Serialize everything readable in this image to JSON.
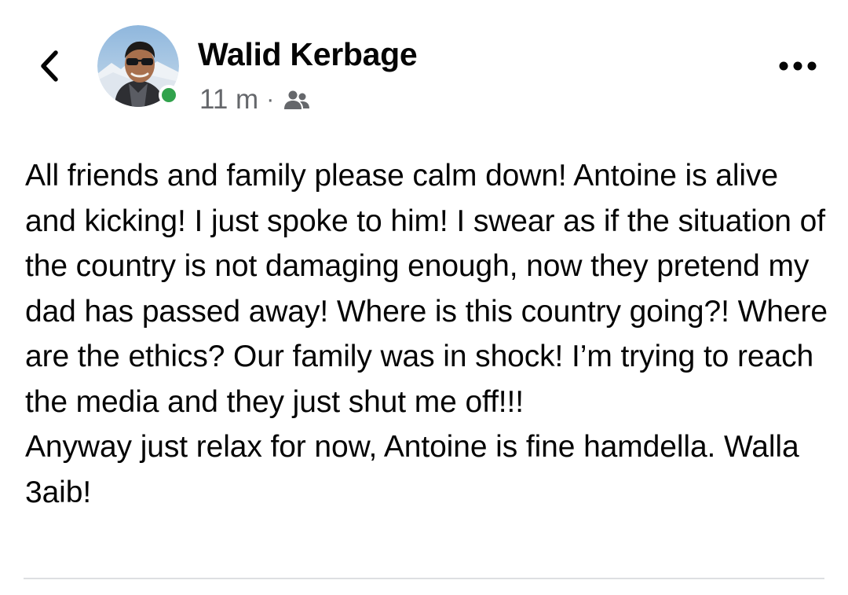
{
  "header": {
    "back_icon": "chevron-left-icon",
    "more_icon": "ellipsis-icon"
  },
  "author": {
    "name": "Walid Kerbage",
    "online": true,
    "avatar": "profile-photo"
  },
  "meta": {
    "time": "11 m",
    "separator": "·",
    "audience_icon": "friends-icon"
  },
  "post": {
    "text": "All friends and family please calm down! Antoine is alive and kicking! I just spoke to him! I swear as if the situation of the country is not damaging enough, now they pretend my dad has passed away! Where is this country going?! Where are the ethics? Our family was in shock! I’m trying to reach the media and they just shut me off!!!\nAnyway just relax for now, Antoine is fine hamdella. Walla 3aib!"
  },
  "colors": {
    "text": "#050505",
    "secondary": "#65676b",
    "online": "#31a24c",
    "divider": "#dddfe2"
  }
}
